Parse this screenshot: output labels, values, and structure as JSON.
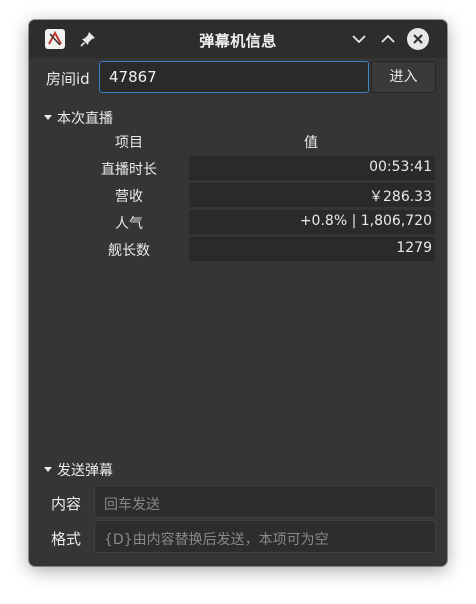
{
  "window": {
    "title": "弹幕机信息",
    "accent_color": "#3d7fc8"
  },
  "titlebar": {
    "icons": [
      "app-logo-icon",
      "pin-icon",
      "chevron-down-icon",
      "chevron-up-icon",
      "close-icon"
    ]
  },
  "room": {
    "label": "房间id",
    "value": "47867",
    "enter_label": "进入"
  },
  "live": {
    "header": "本次直播",
    "col_item": "项目",
    "col_value": "值",
    "rows": [
      {
        "key": "直播时长",
        "value": "00:53:41"
      },
      {
        "key": "营收",
        "value": "￥286.33"
      },
      {
        "key": "人气",
        "value": "+0.8% | 1,806,720"
      },
      {
        "key": "舰长数",
        "value": "1279"
      }
    ]
  },
  "send": {
    "header": "发送弹幕",
    "content_label": "内容",
    "content_placeholder": "回车发送",
    "format_label": "格式",
    "format_placeholder": "{D}由内容替换后发送，本项可为空"
  }
}
